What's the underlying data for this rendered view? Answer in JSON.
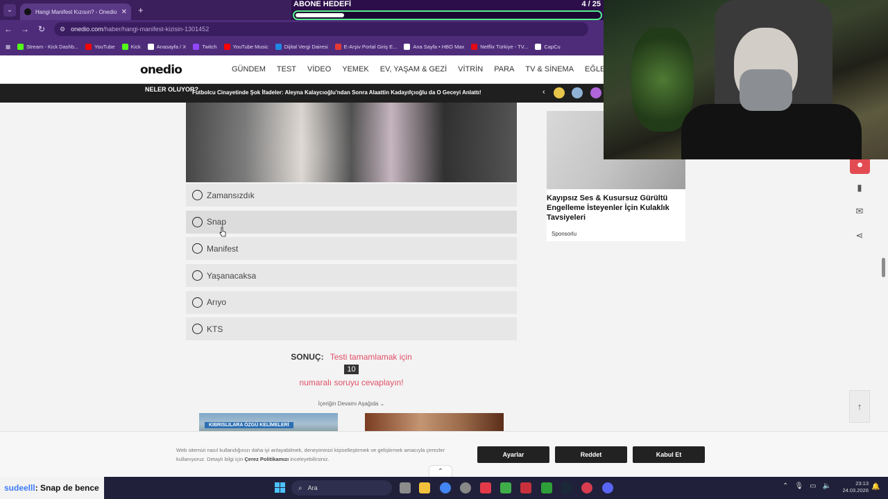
{
  "browser": {
    "tab_title": "Hangi Manifest Kızısın? - Onedio",
    "url_domain": "onedio.com",
    "url_path": "/haber/hangi-manifest-kizisin-1301452",
    "bookmarks": [
      {
        "label": "Stream - Kick Dashb...",
        "icon": "kick-icon",
        "color": "#53fc18"
      },
      {
        "label": "YouTube",
        "icon": "youtube-icon",
        "color": "#ff0000"
      },
      {
        "label": "Kick",
        "icon": "kick-icon",
        "color": "#53fc18"
      },
      {
        "label": "Anasayfa / X",
        "icon": "x-icon",
        "color": "#ffffff"
      },
      {
        "label": "Twitch",
        "icon": "twitch-icon",
        "color": "#9146ff"
      },
      {
        "label": "YouTube Music",
        "icon": "youtube-music-icon",
        "color": "#ff0000"
      },
      {
        "label": "Dijital Vergi Dairesi",
        "icon": "tax-office-icon",
        "color": "#1e88e5"
      },
      {
        "label": "E-Arşiv Portal Giriş E...",
        "icon": "earsiv-icon",
        "color": "#e53935"
      },
      {
        "label": "Ana Sayfa • HBO Max",
        "icon": "hbo-icon",
        "color": "#ffffff"
      },
      {
        "label": "Netflix Türkiye - TV...",
        "icon": "netflix-icon",
        "color": "#e50914"
      },
      {
        "label": "CapCu",
        "icon": "capcut-icon",
        "color": "#ffffff"
      }
    ]
  },
  "goal": {
    "title": "ABONE HEDEFİ",
    "count": "4 / 25",
    "progress": 0.16
  },
  "site": {
    "logo": "onedio",
    "menu": [
      "GÜNDEM",
      "TEST",
      "VİDEO",
      "YEMEK",
      "EV, YAŞAM & GEZİ",
      "VİTRİN",
      "PARA",
      "TV & SİNEMA",
      "EĞLEN"
    ],
    "ticker_label": "NELER OLUYOR?",
    "ticker_text": "Futbolcu Cinayetinde Şok İfadeler: Aleyna Kalaycıoğlu'ndan Sonra Alaattin Kadayıfçıoğlu da O Geceyi Anlattı!"
  },
  "quiz": {
    "options": [
      "Zamansızdık",
      "Snap",
      "Manifest",
      "Yaşanacaksa",
      "Arıyo",
      "KTS"
    ],
    "hovered_option": "Snap",
    "result_label": "SONUÇ:",
    "result_msg_part1": "Testi tamamlamak için",
    "result_number": "10",
    "result_msg_part2": "numaralı soruyu cevaplayın!",
    "more_label": "İçeriğin Devamı Aşağıda ⌄",
    "thumb1_label": "KIBRISLILARA ÖZGÜ KELİMELERİ"
  },
  "ad": {
    "title": "Kayıpsız Ses & Kusursuz Gürültü Engelleme İsteyenler İçin Kulaklık Tavsiyeleri",
    "sponsor": "Sponsorlu"
  },
  "cookie": {
    "text_part1": "Web sitemizi nasıl kullandığınızı daha iyi anlayabilmek, deneyiminizi kişiselleştirmek ve geliştirmek amacıyla çerezler kullanıyoruz. Detaylı bilgi için",
    "text_link": "Çerez Politikamızı",
    "text_part2": "inceleyebilirsiniz.",
    "settings": "Ayarlar",
    "reject": "Reddet",
    "accept": "Kabul Et"
  },
  "chat": {
    "user": "sudeelll",
    "message": ": Snap de bence"
  },
  "taskbar": {
    "search_placeholder": "Ara",
    "time": "23:13",
    "date": "24.03.2026"
  }
}
